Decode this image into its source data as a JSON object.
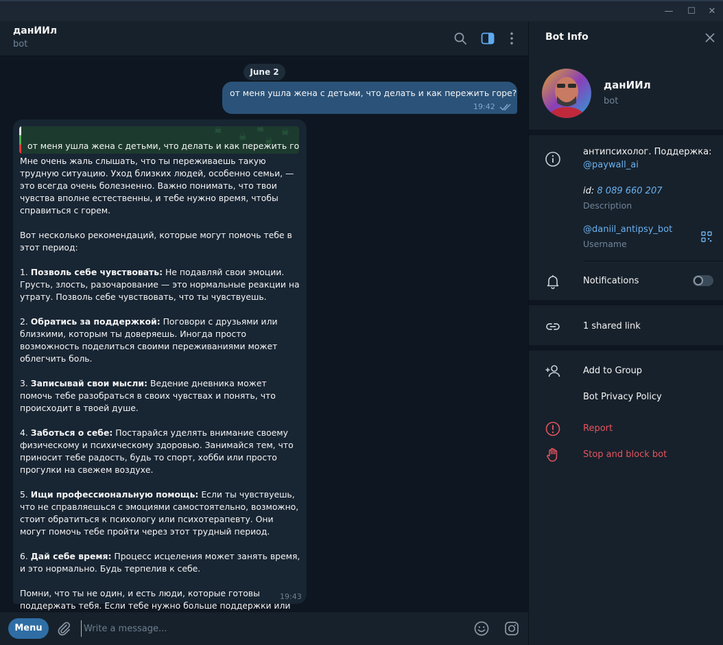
{
  "window": {
    "minimize": "—",
    "maximize": "☐",
    "close": "✕"
  },
  "chat": {
    "title": "данИИл",
    "subtitle": "bot",
    "date": "June 2",
    "outgoing": {
      "text": "от меня ушла жена с детьми, что делать и как пережить горе?",
      "time": "19:42"
    },
    "incoming": {
      "reply_quote": "от меня ушла жена с детьми, что делать и как пережить горе?",
      "paragraphs": [
        {
          "plain": "Мне очень жаль слышать, что ты переживаешь такую трудную ситуацию. Уход близких людей, особенно семьи, — это всегда очень болезненно. Важно понимать, что твои чувства вполне естественны, и тебе нужно время, чтобы справиться с горем."
        },
        {
          "plain": "Вот несколько рекомендаций, которые могут помочь тебе в этот период:"
        },
        {
          "num": "1. ",
          "bold": "Позволь себе чувствовать:",
          "plain": " Не подавляй свои эмоции. Грусть, злость, разочарование — это нормальные реакции на утрату. Позволь себе чувствовать, что ты чувствуешь."
        },
        {
          "num": "2. ",
          "bold": "Обратись за поддержкой:",
          "plain": " Поговори с друзьями или близкими, которым ты доверяешь. Иногда просто возможность поделиться своими переживаниями может облегчить боль."
        },
        {
          "num": "3. ",
          "bold": "Записывай свои мысли:",
          "plain": " Ведение дневника может помочь тебе разобраться в своих чувствах и понять, что происходит в твоей душе."
        },
        {
          "num": "4. ",
          "bold": "Заботься о себе:",
          "plain": " Постарайся уделять внимание своему физическому и психическому здоровью. Занимайся тем, что приносит тебе радость, будь то спорт, хобби или просто прогулки на свежем воздухе."
        },
        {
          "num": "5. ",
          "bold": "Ищи профессиональную помощь:",
          "plain": " Если ты чувствуешь, что не справляешься с эмоциями самостоятельно, возможно, стоит обратиться к психологу или психотерапевту. Они могут помочь тебе пройти через этот трудный период."
        },
        {
          "num": "6. ",
          "bold": "Дай себе время:",
          "plain": " Процесс исцеления может занять время, и это нормально. Будь терпелив к себе."
        },
        {
          "plain": "Помни, что ты не один, и есть люди, которые готовы поддержать тебя. Если тебе нужно больше поддержки или советов, не стесняйся обращаться."
        }
      ],
      "time": "19:43"
    },
    "composer": {
      "menu_label": "Menu",
      "placeholder": "Write a message..."
    }
  },
  "panel": {
    "title": "Bot Info",
    "bot_name": "данИИл",
    "bot_sub": "bot",
    "bio_text": "антипсихолог. Поддержка:",
    "bio_link": "@paywall_ai",
    "id_label": "id:",
    "id_value": "8 089 660 207",
    "description_label": "Description",
    "username": "@daniil_antipsy_bot",
    "username_label": "Username",
    "notifications": "Notifications",
    "notifications_on": false,
    "shared_link": "1 shared link",
    "add_to_group": "Add to Group",
    "privacy": "Bot Privacy Policy",
    "report": "Report",
    "stop_block": "Stop and block bot"
  },
  "colors": {
    "accent": "#2f6ea5",
    "link": "#6ab2f2",
    "danger": "#e5545f",
    "outgoing_bubble": "#2b5278",
    "incoming_bubble": "#182533"
  }
}
